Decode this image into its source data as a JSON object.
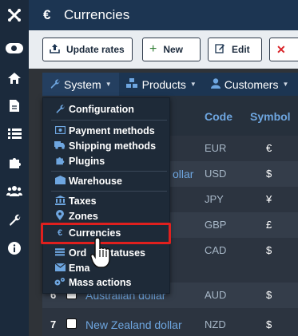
{
  "rail": {
    "icons": [
      "joomla-icon",
      "toggle-icon",
      "home-icon",
      "document-icon",
      "list-icon",
      "puzzle-icon",
      "users-icon",
      "wrench-icon",
      "info-icon"
    ]
  },
  "header": {
    "icon": "€",
    "title": "Currencies"
  },
  "toolbar": {
    "update_rates": "Update rates",
    "new": "New",
    "edit": "Edit"
  },
  "menubar": {
    "system": "System",
    "products": "Products",
    "customers": "Customers"
  },
  "table": {
    "headers": {
      "code": "Code",
      "symbol": "Symbol"
    },
    "rows": [
      {
        "num": "",
        "name": "",
        "code": "EUR",
        "symbol": "€"
      },
      {
        "num": "",
        "name": "ollar",
        "code": "USD",
        "symbol": "$"
      },
      {
        "num": "",
        "name": "",
        "code": "JPY",
        "symbol": "¥"
      },
      {
        "num": "",
        "name": "",
        "code": "GBP",
        "symbol": "£"
      },
      {
        "num": "",
        "name": "",
        "code": "CAD",
        "symbol": "$"
      },
      {
        "num": "6",
        "name": "Australian dollar",
        "code": "AUD",
        "symbol": "$"
      },
      {
        "num": "7",
        "name": "New Zealand dollar",
        "code": "NZD",
        "symbol": "$"
      }
    ]
  },
  "dropdown": {
    "items": [
      {
        "label": "Configuration",
        "icon": "wrench-icon"
      },
      {
        "label": "Payment methods",
        "icon": "money-icon"
      },
      {
        "label": "Shipping methods",
        "icon": "truck-icon"
      },
      {
        "label": "Plugins",
        "icon": "puzzle-icon"
      },
      {
        "label": "Warehouse",
        "icon": "warehouse-icon"
      },
      {
        "label": "Taxes",
        "icon": "bank-icon"
      },
      {
        "label": "Zones",
        "icon": "map-pin-icon"
      },
      {
        "label": "Currencies",
        "icon": "euro-icon"
      },
      {
        "label": "Ord",
        "label_tail": "tatuses",
        "icon": "list-icon"
      },
      {
        "label": "Ema",
        "icon": "envelope-icon"
      },
      {
        "label": "Mass actions",
        "icon": "cogs-icon"
      }
    ],
    "highlighted": "Currencies"
  },
  "colors": {
    "rail": "#1b2a3c",
    "header": "#1c3552",
    "accent": "#6ea6e0",
    "highlight": "#e0201e"
  }
}
